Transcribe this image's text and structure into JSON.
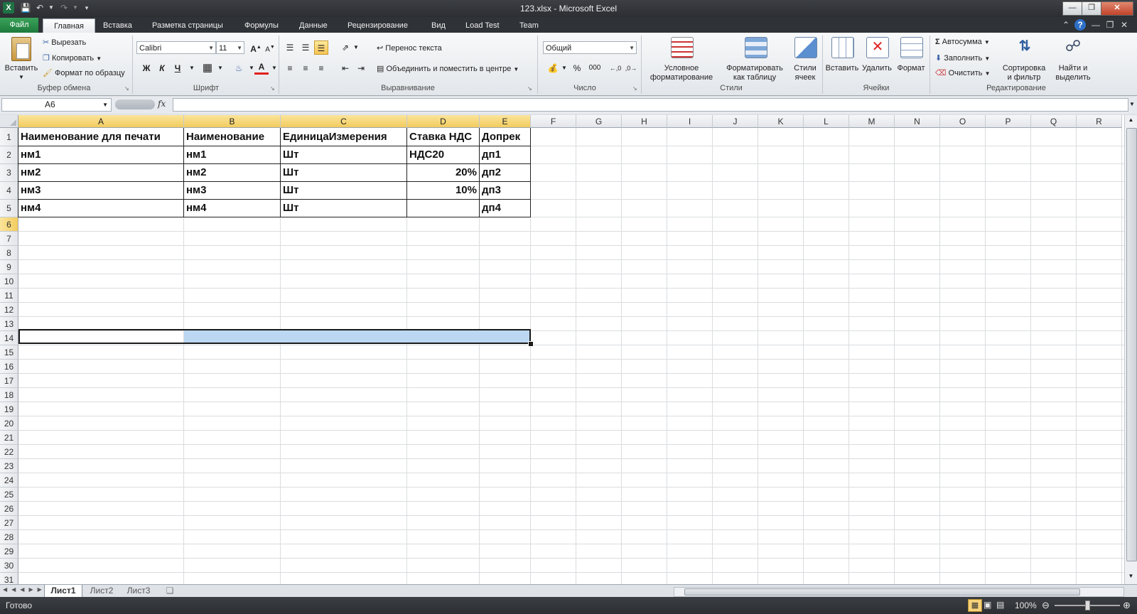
{
  "window": {
    "title": "123.xlsx - Microsoft Excel"
  },
  "ribbon_tabs": [
    {
      "label": "Файл"
    },
    {
      "label": "Главная"
    },
    {
      "label": "Вставка"
    },
    {
      "label": "Разметка страницы"
    },
    {
      "label": "Формулы"
    },
    {
      "label": "Данные"
    },
    {
      "label": "Рецензирование"
    },
    {
      "label": "Вид"
    },
    {
      "label": "Load Test"
    },
    {
      "label": "Team"
    }
  ],
  "clipboard": {
    "paste": "Вставить",
    "cut": "Вырезать",
    "copy": "Копировать",
    "format_painter": "Формат по образцу",
    "label": "Буфер обмена"
  },
  "font": {
    "name": "Calibri",
    "size": "11",
    "bold": "Ж",
    "italic": "К",
    "underline": "Ч",
    "label": "Шрифт"
  },
  "alignment": {
    "wrap": "Перенос текста",
    "merge": "Объединить и поместить в центре",
    "label": "Выравнивание"
  },
  "number": {
    "format": "Общий",
    "percent": "%",
    "thousands": "000",
    "label": "Число"
  },
  "styles": {
    "conditional_l1": "Условное",
    "conditional_l2": "форматирование",
    "as_table_l1": "Форматировать",
    "as_table_l2": "как таблицу",
    "cell_styles_l1": "Стили",
    "cell_styles_l2": "ячеек",
    "label": "Стили"
  },
  "cells": {
    "insert": "Вставить",
    "delete": "Удалить",
    "format": "Формат",
    "label": "Ячейки"
  },
  "editing": {
    "autosum": "Автосумма",
    "fill": "Заполнить",
    "clear": "Очистить",
    "sort_l1": "Сортировка",
    "sort_l2": "и фильтр",
    "find_l1": "Найти и",
    "find_l2": "выделить",
    "label": "Редактирование"
  },
  "formula_bar": {
    "name_box": "A6",
    "fx": "fx",
    "value": ""
  },
  "columns": [
    "A",
    "B",
    "C",
    "D",
    "E",
    "F",
    "G",
    "H",
    "I",
    "J",
    "K",
    "L",
    "M",
    "N",
    "O",
    "P",
    "Q",
    "R"
  ],
  "rows": [
    "1",
    "2",
    "3",
    "4",
    "5",
    "6",
    "7",
    "8",
    "9",
    "10",
    "11",
    "12",
    "13",
    "14",
    "15",
    "16",
    "17",
    "18",
    "19",
    "20",
    "21",
    "22",
    "23",
    "24",
    "25",
    "26",
    "27",
    "28",
    "29",
    "30",
    "31"
  ],
  "table": [
    [
      "Наименование для печати",
      "Наименование",
      "ЕдиницаИзмерения",
      "Ставка НДС",
      "Допрек"
    ],
    [
      "нм1",
      "нм1",
      "Шт",
      "НДС20",
      "дп1"
    ],
    [
      "нм2",
      "нм2",
      "Шт",
      "20%",
      "дп2"
    ],
    [
      "нм3",
      "нм3",
      "Шт",
      "10%",
      "дп3"
    ],
    [
      "нм4",
      "нм4",
      "Шт",
      "",
      "дп4"
    ]
  ],
  "sheets": [
    "Лист1",
    "Лист2",
    "Лист3"
  ],
  "status": {
    "ready": "Готово",
    "zoom": "100%"
  }
}
